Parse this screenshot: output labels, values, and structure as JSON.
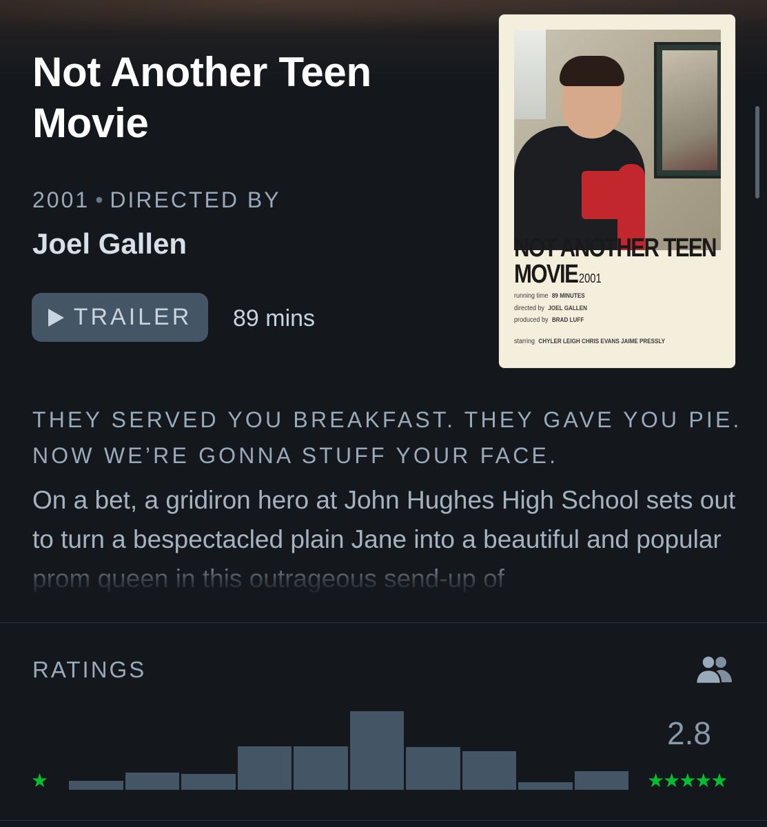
{
  "film": {
    "title": "Not Another Teen Movie",
    "year": "2001",
    "directed_by_label": "DIRECTED BY",
    "director": "Joel Gallen",
    "trailer_label": "TRAILER",
    "runtime": "89 mins",
    "tagline": "THEY SERVED YOU BREAKFAST. THEY GAVE YOU PIE. NOW WE’RE GONNA STUFF YOUR FACE.",
    "synopsis": "On a bet, a gridiron hero at John Hughes High School sets out to turn a bespectacled plain Jane into a beautiful and popular prom queen in this outrageous send-up of"
  },
  "poster": {
    "title_line1": "NOT ANOTHER TEEN",
    "title_line2": "MOVIE",
    "year": "2001",
    "running_time_label": "running time",
    "running_time_value": "89 MINUTES",
    "directed_label": "directed by",
    "directed_value": "JOEL GALLEN",
    "produced_label": "produced by",
    "produced_value": "BRAD LUFF",
    "starring_label": "starring",
    "starring_value": "CHYLER LEIGH   CHRIS EVANS   JAIME PRESSLY"
  },
  "ratings": {
    "label": "RATINGS",
    "average": "2.8",
    "min_stars": "★",
    "max_stars": "★★★★★",
    "histogram": [
      0.11,
      0.22,
      0.2,
      0.55,
      0.55,
      1.0,
      0.54,
      0.49,
      0.1,
      0.24
    ],
    "accent_color": "#00c030",
    "bar_color": "#445566",
    "friends_icon": "people-icon"
  }
}
